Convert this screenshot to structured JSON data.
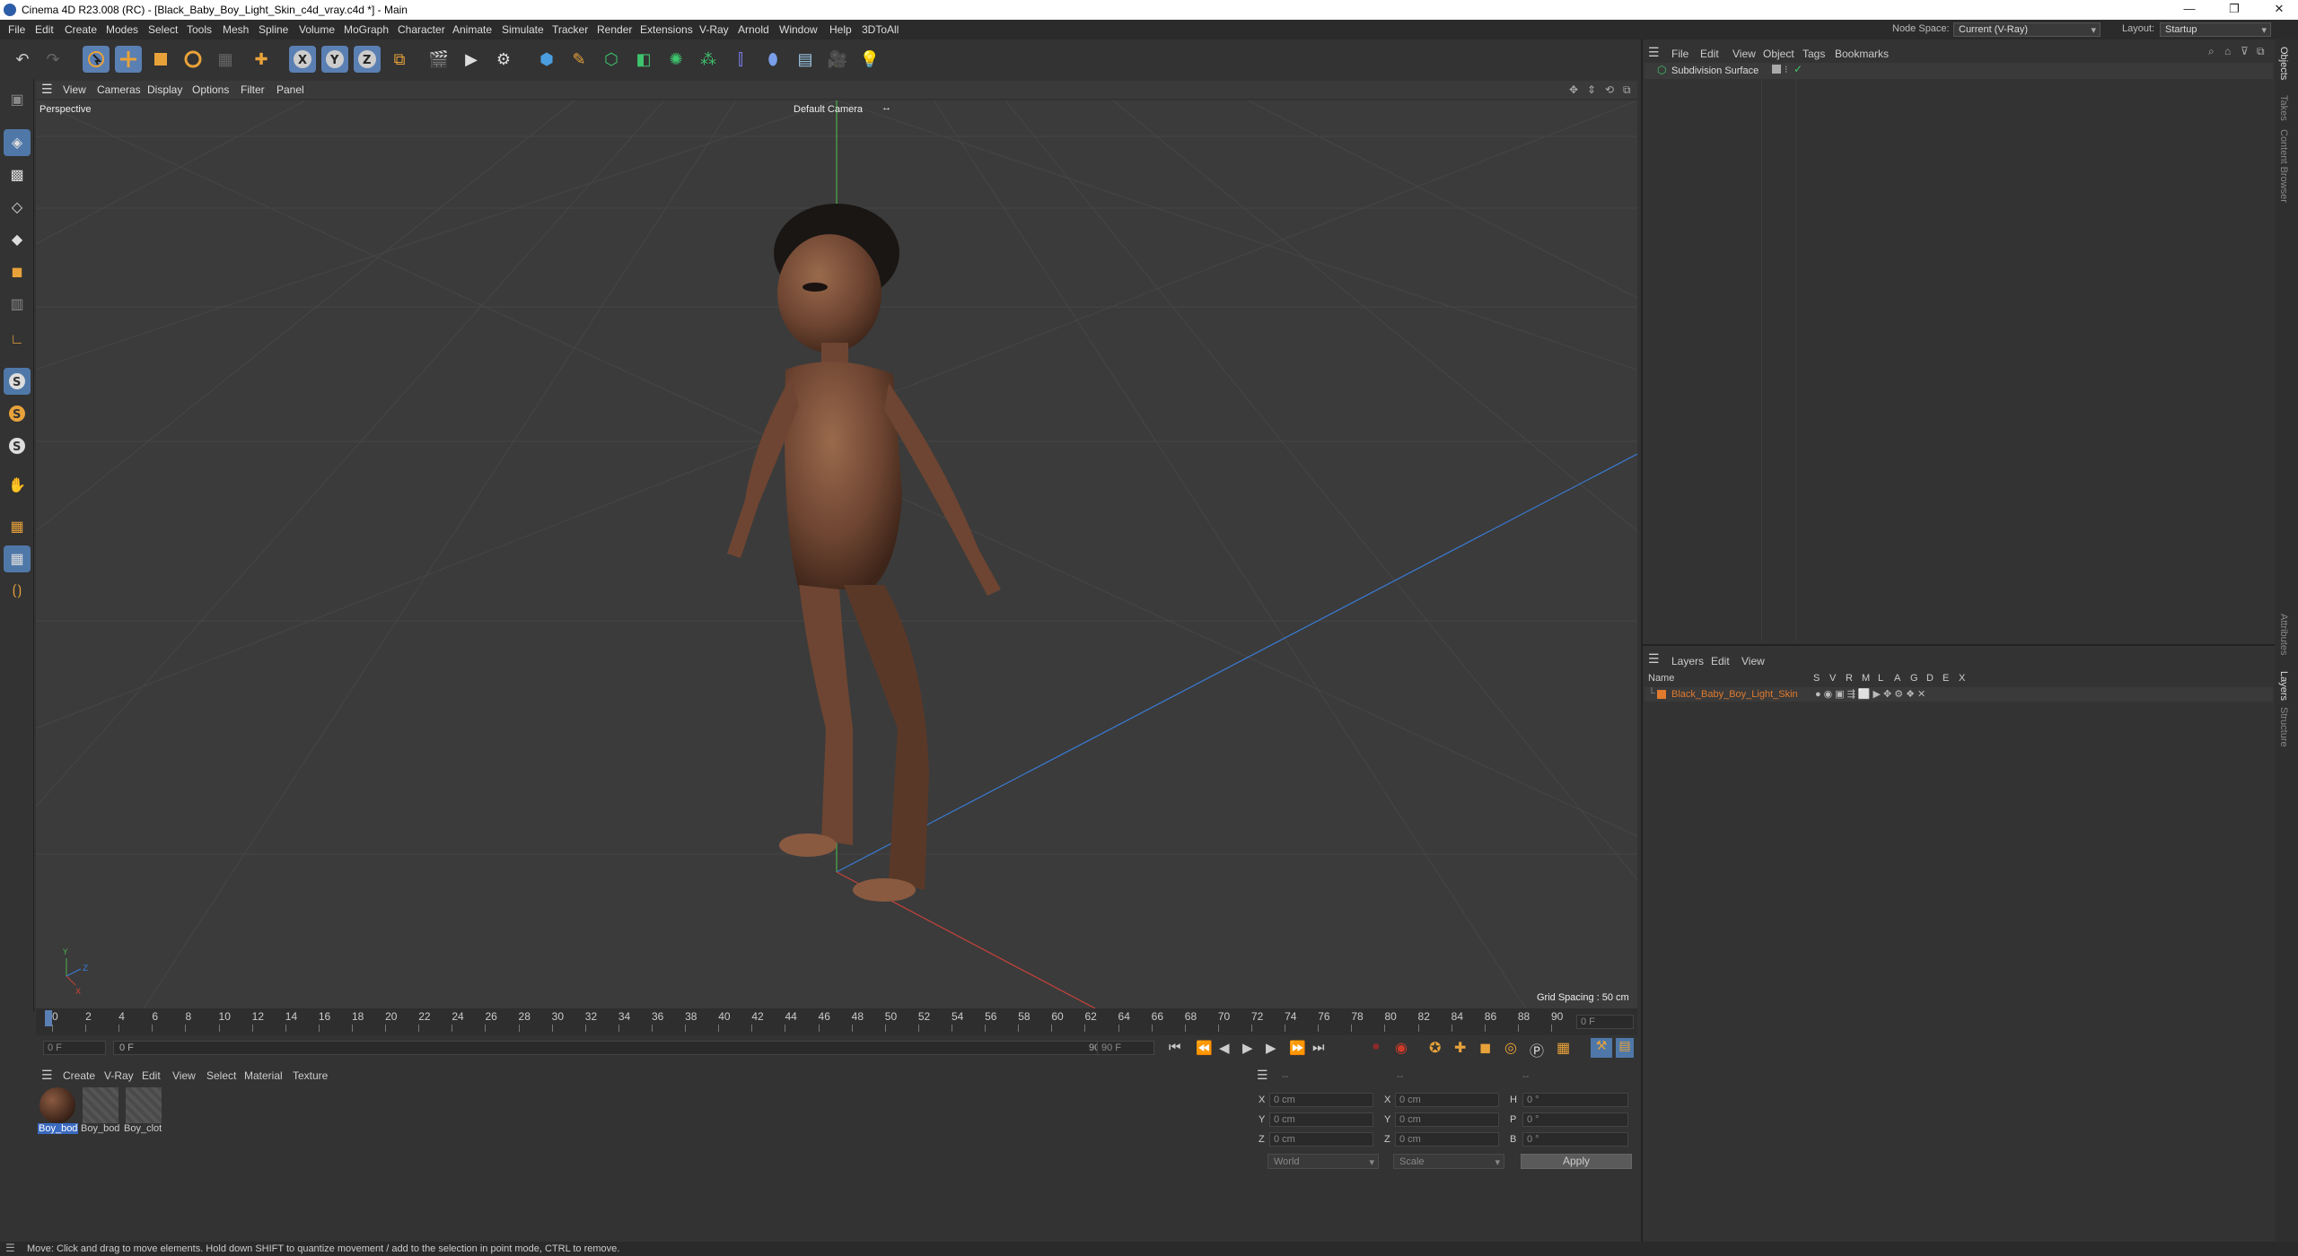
{
  "window": {
    "title": "Cinema 4D R23.008 (RC) - [Black_Baby_Boy_Light_Skin_c4d_vray.c4d *] - Main",
    "minimize": "—",
    "restore": "❐",
    "close": "✕"
  },
  "menubar": {
    "items": [
      "File",
      "Edit",
      "Create",
      "Modes",
      "Select",
      "Tools",
      "Mesh",
      "Spline",
      "Volume",
      "MoGraph",
      "Character",
      "Animate",
      "Simulate",
      "Tracker",
      "Render",
      "Extensions",
      "V-Ray",
      "Arnold",
      "Window",
      "Help",
      "3DToAll"
    ],
    "node_space_label": "Node Space:",
    "node_space_value": "Current (V-Ray)",
    "layout_label": "Layout:",
    "layout_value": "Startup"
  },
  "viewport": {
    "menu": [
      "View",
      "Cameras",
      "Display",
      "Options",
      "Filter",
      "Panel"
    ],
    "projection": "Perspective",
    "camera": "Default Camera",
    "grid_spacing": "Grid Spacing : 50 cm"
  },
  "timeline": {
    "ticks": [
      "0",
      "2",
      "4",
      "6",
      "8",
      "10",
      "12",
      "14",
      "16",
      "18",
      "20",
      "22",
      "24",
      "26",
      "28",
      "30",
      "32",
      "34",
      "36",
      "38",
      "40",
      "42",
      "44",
      "46",
      "48",
      "50",
      "52",
      "54",
      "56",
      "58",
      "60",
      "62",
      "64",
      "66",
      "68",
      "70",
      "72",
      "74",
      "76",
      "78",
      "80",
      "82",
      "84",
      "86",
      "88",
      "90"
    ],
    "current_frame": "0 F",
    "start_frame": "0 F",
    "range_start": "0 F",
    "range_end": "90 F",
    "end_frame": "90 F"
  },
  "material_manager": {
    "menu": [
      "Create",
      "V-Ray",
      "Edit",
      "View",
      "Select",
      "Material",
      "Texture"
    ],
    "materials": [
      {
        "name": "Boy_bod",
        "selected": true
      },
      {
        "name": "Boy_bod",
        "selected": false
      },
      {
        "name": "Boy_clot",
        "selected": false
      }
    ]
  },
  "coordinates": {
    "header_dashes": [
      "--",
      "--",
      "--"
    ],
    "rows": [
      {
        "a": "X",
        "av": "0 cm",
        "b": "X",
        "bv": "0 cm",
        "c": "H",
        "cv": "0 °"
      },
      {
        "a": "Y",
        "av": "0 cm",
        "b": "Y",
        "bv": "0 cm",
        "c": "P",
        "cv": "0 °"
      },
      {
        "a": "Z",
        "av": "0 cm",
        "b": "Z",
        "bv": "0 cm",
        "c": "B",
        "cv": "0 °"
      }
    ],
    "mode": "World",
    "transform": "Scale",
    "apply": "Apply"
  },
  "object_manager": {
    "menu": [
      "File",
      "Edit",
      "View",
      "Object",
      "Tags",
      "Bookmarks"
    ],
    "objects": [
      {
        "name": "Subdivision Surface"
      }
    ]
  },
  "layer_manager": {
    "menu": [
      "Layers",
      "Edit",
      "View"
    ],
    "name_header": "Name",
    "columns": [
      "S",
      "V",
      "R",
      "M",
      "L",
      "A",
      "G",
      "D",
      "E",
      "X"
    ],
    "layers": [
      {
        "name": "Black_Baby_Boy_Light_Skin",
        "color": "#e07a2e"
      }
    ]
  },
  "right_tabs": [
    "Objects",
    "Takes",
    "Content Browser",
    "Attributes",
    "Layers",
    "Structure"
  ],
  "status": "Move: Click and drag to move elements. Hold down SHIFT to quantize movement / add to the selection in point mode, CTRL to remove.",
  "colors": {
    "accent": "#5a7fb3",
    "layer_orange": "#e07a2e",
    "x_axis": "#c8423a",
    "y_axis": "#4cae4c",
    "z_axis": "#3a7bd5"
  }
}
